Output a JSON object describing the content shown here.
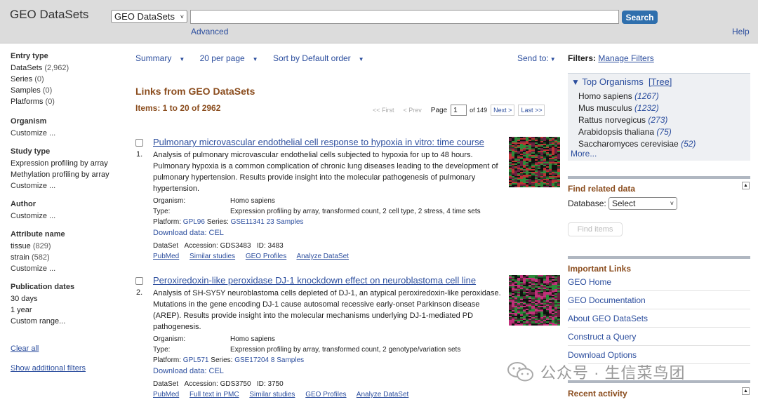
{
  "header": {
    "title": "GEO DataSets",
    "db_select": "GEO DataSets",
    "search_value": "",
    "search_button": "Search",
    "advanced": "Advanced",
    "help": "Help"
  },
  "filters": {
    "entry_type": {
      "title": "Entry type",
      "items": [
        {
          "label": "DataSets",
          "count": "(2,962)"
        },
        {
          "label": "Series",
          "count": "(0)"
        },
        {
          "label": "Samples",
          "count": "(0)"
        },
        {
          "label": "Platforms",
          "count": "(0)"
        }
      ]
    },
    "organism": {
      "title": "Organism",
      "customize": "Customize ..."
    },
    "study_type": {
      "title": "Study type",
      "items": [
        "Expression profiling by array",
        "Methylation profiling by array"
      ],
      "customize": "Customize ..."
    },
    "author": {
      "title": "Author",
      "customize": "Customize ..."
    },
    "attribute": {
      "title": "Attribute name",
      "items": [
        {
          "label": "tissue",
          "count": "(829)"
        },
        {
          "label": "strain",
          "count": "(582)"
        }
      ],
      "customize": "Customize ..."
    },
    "pub_dates": {
      "title": "Publication dates",
      "items": [
        "30 days",
        "1 year",
        "Custom range..."
      ]
    },
    "clear_all": "Clear all",
    "show_additional": "Show additional filters"
  },
  "toolbar": {
    "summary": "Summary",
    "per_page": "20 per page",
    "sort": "Sort by Default order",
    "send_to": "Send to:"
  },
  "results_header": {
    "title": "Links from GEO DataSets",
    "items": "Items: 1 to 20 of 2962",
    "first": "<< First",
    "prev": "< Prev",
    "page_label": "Page",
    "page_value": "1",
    "of_pages": "of 149",
    "next": "Next >",
    "last": "Last >>"
  },
  "results": [
    {
      "num": "1.",
      "title": "Pulmonary microvascular endothelial cell response to hypoxia in vitro: time course",
      "desc": "Analysis of pulmonary microvascular endothelial cells subjected to hypoxia for up to 48 hours. Pulmonary hypoxia is a common complication of chronic lung diseases leading to the development of pulmonary hypertension. Results provide insight into the molecular pathogenesis of pulmonary hypertension.",
      "organism_label": "Organism:",
      "organism": "Homo sapiens",
      "type_label": "Type:",
      "type": "Expression profiling by array, transformed count, 2 cell type, 2 stress, 4 time sets",
      "platform_label": "Platform:",
      "platform": "GPL96",
      "series_label": "Series:",
      "series": "GSE11341",
      "samples": "23 Samples",
      "download": "Download data: CEL",
      "dataset_label": "DataSet",
      "accession": "Accession: GDS3483",
      "id": "ID: 3483",
      "links": [
        "PubMed",
        "Similar studies",
        "GEO Profiles",
        "Analyze DataSet"
      ]
    },
    {
      "num": "2.",
      "title": "Peroxiredoxin-like peroxidase DJ-1 knockdown effect on neuroblastoma cell line",
      "desc": "Analysis of SH-SY5Y neuroblastoma cells depleted of DJ-1, an atypical peroxiredoxin-like peroxidase. Mutations in the gene encoding DJ-1 cause autosomal recessive early-onset Parkinson disease (AREP). Results provide insight into the molecular mechanisms underlying DJ-1-mediated PD pathogenesis.",
      "organism_label": "Organism:",
      "organism": "Homo sapiens",
      "type_label": "Type:",
      "type": "Expression profiling by array, transformed count, 2 genotype/variation sets",
      "platform_label": "Platform:",
      "platform": "GPL571",
      "series_label": "Series:",
      "series": "GSE17204",
      "samples": "8 Samples",
      "download": "Download data: CEL",
      "dataset_label": "DataSet",
      "accession": "Accession: GDS3750",
      "id": "ID: 3750",
      "links": [
        "PubMed",
        "Full text in PMC",
        "Similar studies",
        "GEO Profiles",
        "Analyze DataSet"
      ]
    }
  ],
  "right": {
    "filters_label": "Filters:",
    "manage_filters": "Manage Filters",
    "top_organisms": "Top Organisms",
    "tree": "[Tree]",
    "organisms": [
      {
        "name": "Homo sapiens",
        "count": "(1267)"
      },
      {
        "name": "Mus musculus",
        "count": "(1232)"
      },
      {
        "name": "Rattus norvegicus",
        "count": "(273)"
      },
      {
        "name": "Arabidopsis thaliana",
        "count": "(75)"
      },
      {
        "name": "Saccharomyces cerevisiae",
        "count": "(52)"
      }
    ],
    "more": "More...",
    "find_related": "Find related data",
    "database_label": "Database:",
    "database_value": "Select",
    "find_items": "Find items",
    "important_links": "Important Links",
    "links": [
      "GEO Home",
      "GEO Documentation",
      "About GEO DataSets",
      "Construct a Query",
      "Download Options"
    ],
    "recent_activity": "Recent activity"
  },
  "watermark": "公众号 · 生信菜鸟团",
  "colors": {
    "link": "#2c4e9e",
    "heading": "#8b4d1e",
    "search_button": "#2f6fad",
    "header_bg": "#dcdcdc"
  }
}
